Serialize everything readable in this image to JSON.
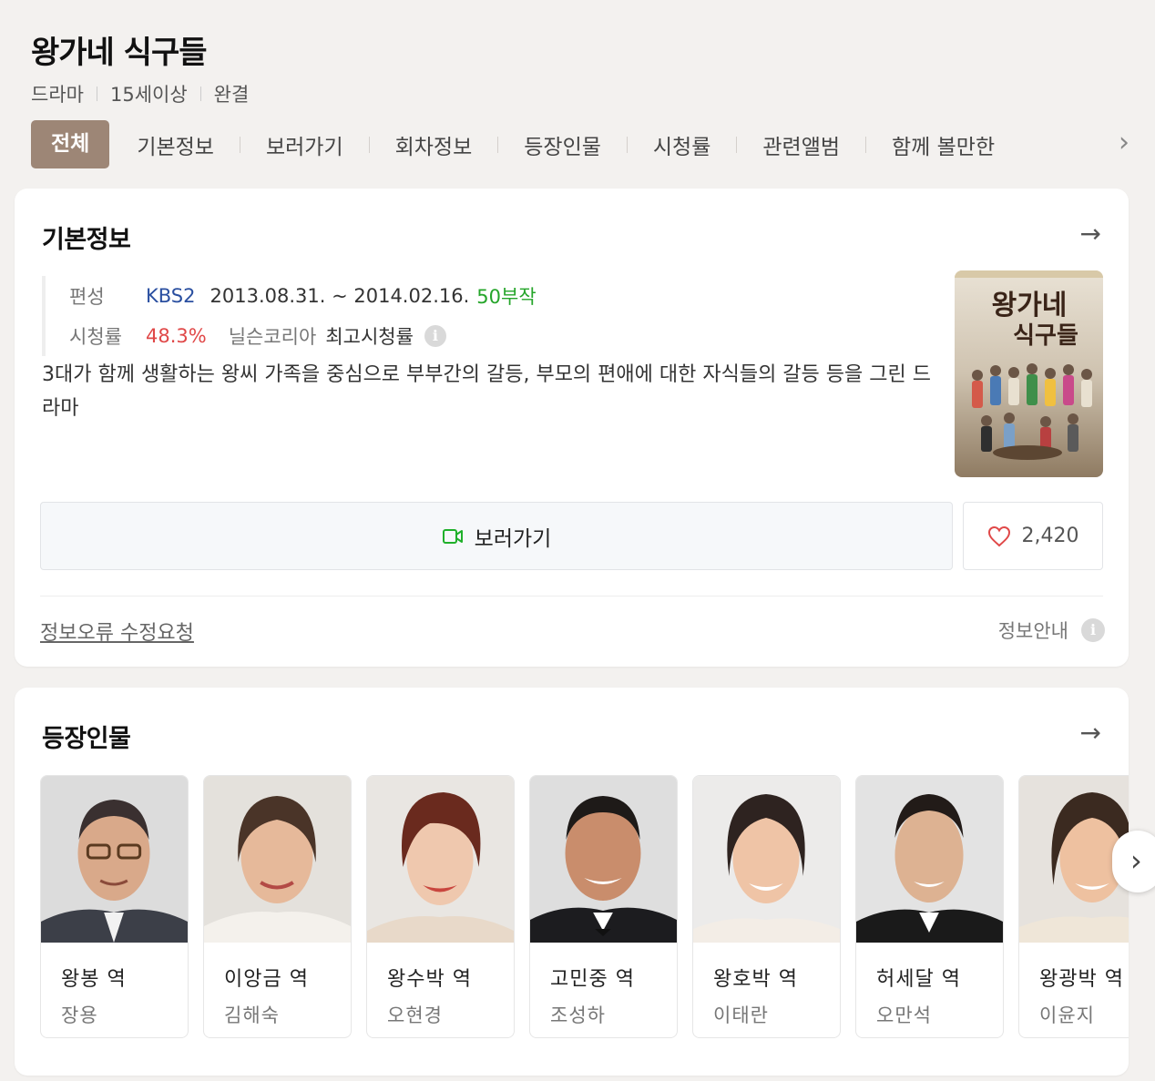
{
  "header": {
    "title": "왕가네 식구들",
    "meta": [
      "드라마",
      "15세이상",
      "완결"
    ]
  },
  "tabs": [
    "전체",
    "기본정보",
    "보러가기",
    "회차정보",
    "등장인물",
    "시청률",
    "관련앨범",
    "함께 볼만한"
  ],
  "basic": {
    "section_title": "기본정보",
    "broadcast_label": "편성",
    "channel": "KBS2",
    "period": "2013.08.31. ~ 2014.02.16.",
    "episodes": "50부작",
    "rating_label": "시청률",
    "rating": "48.3%",
    "rating_source": "닐슨코리아",
    "rating_type": "최고시청률",
    "description": "3대가 함께 생활하는 왕씨 가족을 중심으로 부부간의 갈등, 부모의 편애에 대한 자식들의 갈등 등을 그린 드라마",
    "poster_text": "왕가네 식구들",
    "watch_label": "보러가기",
    "likes": "2,420",
    "report_label": "정보오류 수정요청",
    "guide_label": "정보안내"
  },
  "cast_section": {
    "title": "등장인물",
    "members": [
      {
        "role": "왕봉 역",
        "actor": "장용"
      },
      {
        "role": "이앙금 역",
        "actor": "김해숙"
      },
      {
        "role": "왕수박 역",
        "actor": "오현경"
      },
      {
        "role": "고민중 역",
        "actor": "조성하"
      },
      {
        "role": "왕호박 역",
        "actor": "이태란"
      },
      {
        "role": "허세달 역",
        "actor": "오만석"
      },
      {
        "role": "왕광박 역",
        "actor": "이윤지"
      }
    ]
  },
  "colors": {
    "active_tab": "#9d8676",
    "channel": "#2a4fa0",
    "episodes": "#25a52a",
    "rating": "#e04848"
  }
}
